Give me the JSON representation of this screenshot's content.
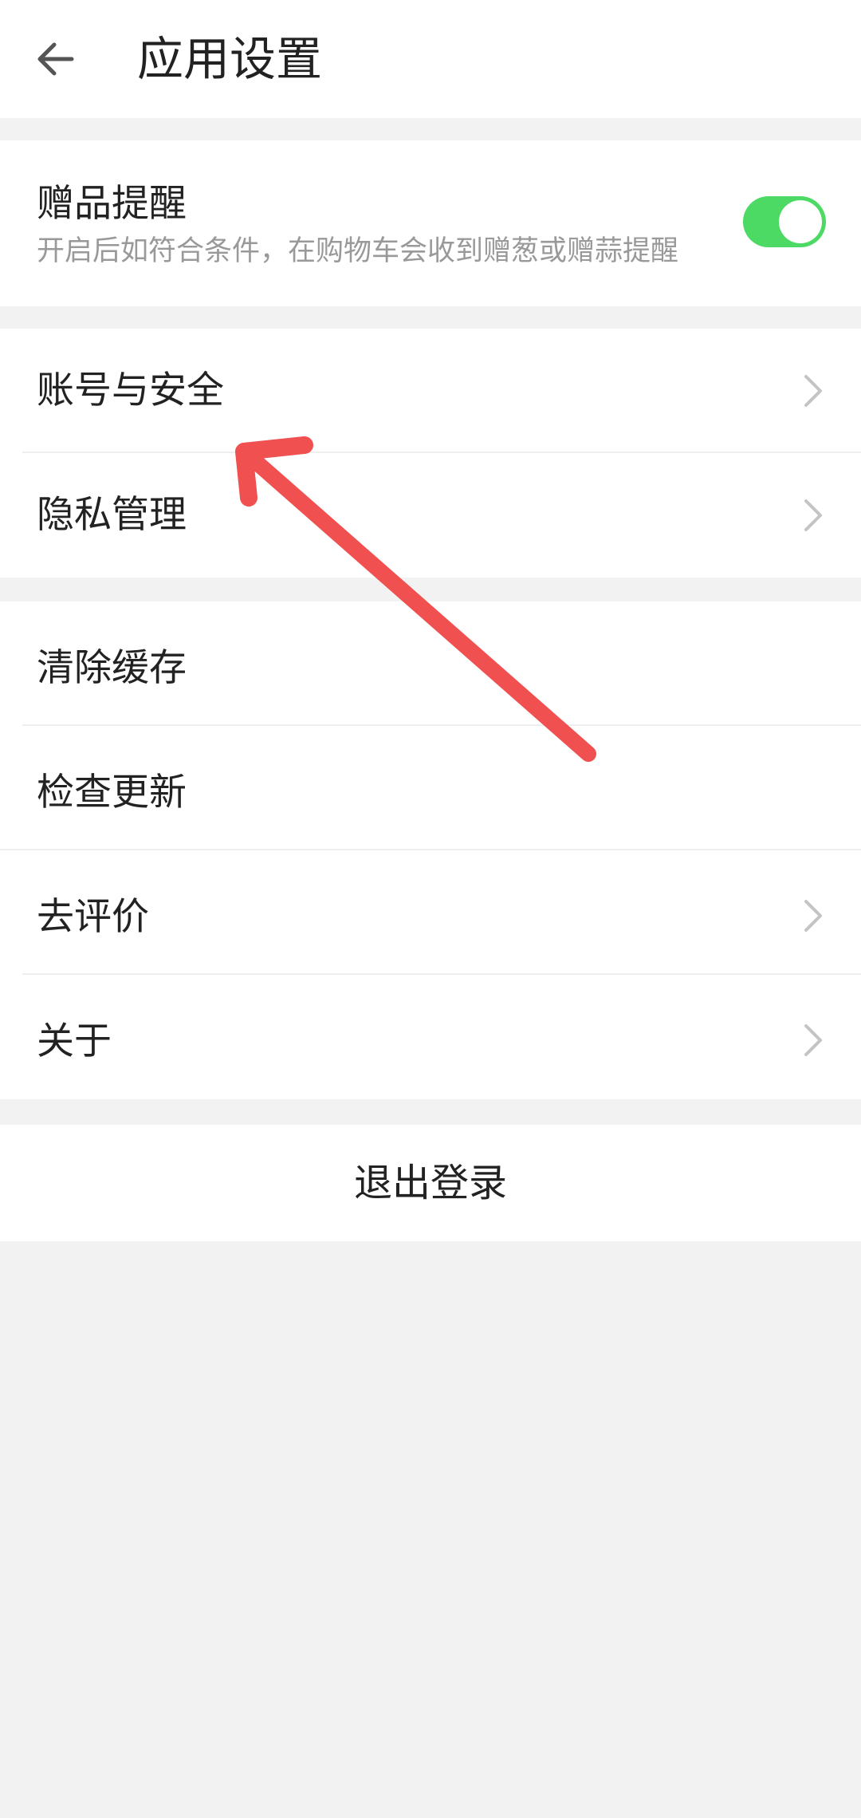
{
  "header": {
    "title": "应用设置",
    "back_icon": "arrow-left-icon"
  },
  "gift": {
    "title": "赠品提醒",
    "description": "开启后如符合条件，在购物车会收到赠葱或赠蒜提醒",
    "toggle_on": true,
    "toggle_color": "#4cd964"
  },
  "account_section": {
    "items": [
      {
        "label": "账号与安全",
        "has_chevron": true
      },
      {
        "label": "隐私管理",
        "has_chevron": true
      }
    ]
  },
  "misc_section": {
    "items": [
      {
        "label": "清除缓存",
        "has_chevron": false
      },
      {
        "label": "检查更新",
        "has_chevron": false
      },
      {
        "label": "去评价",
        "has_chevron": true
      },
      {
        "label": "关于",
        "has_chevron": true
      }
    ]
  },
  "logout": {
    "label": "退出登录"
  },
  "annotation": {
    "color": "#f05050",
    "points_to": "账号与安全"
  }
}
